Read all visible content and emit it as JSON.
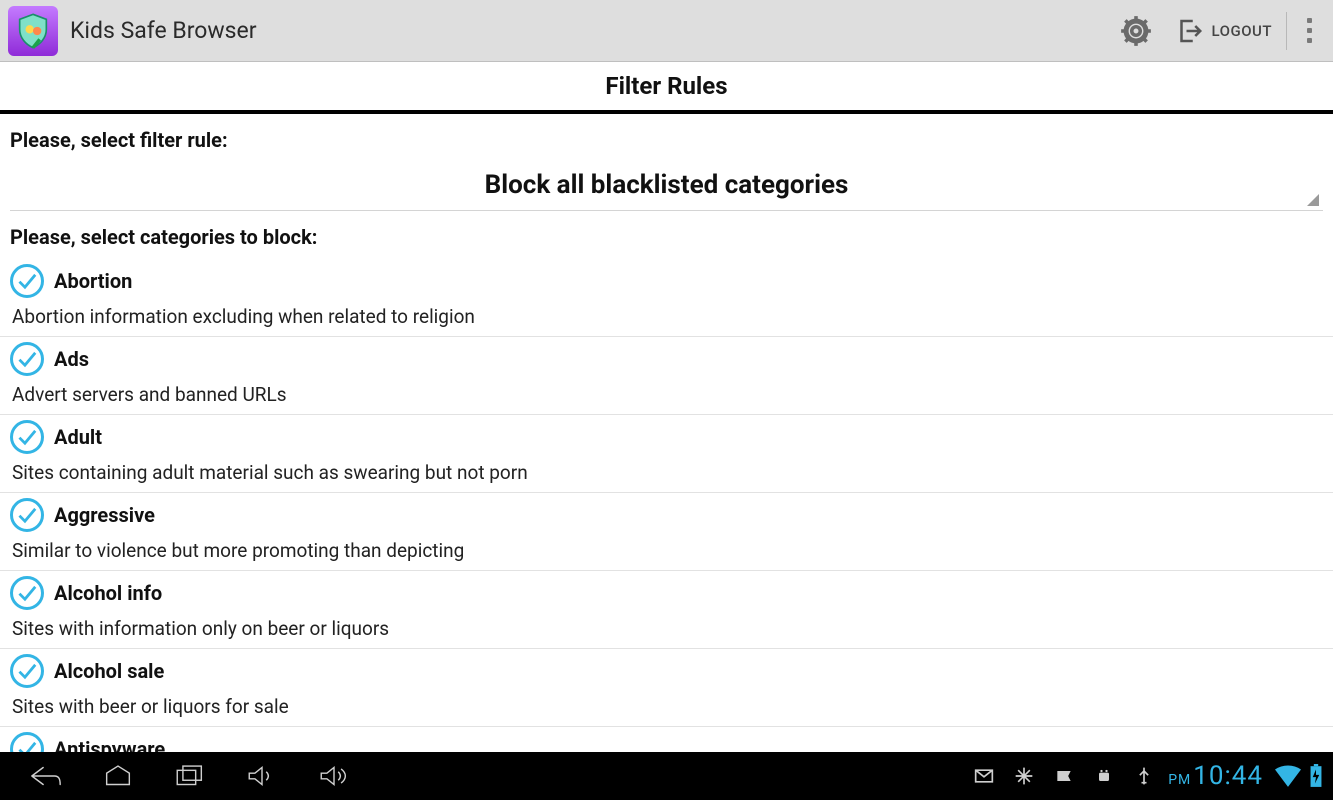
{
  "header": {
    "app_title": "Kids Safe Browser",
    "logout_label": "LOGOUT"
  },
  "page": {
    "title": "Filter Rules",
    "select_rule_label": "Please, select filter rule:",
    "selected_rule": "Block all blacklisted categories",
    "select_categories_label": "Please, select categories to block:",
    "categories": [
      {
        "title": "Abortion",
        "desc": "Abortion information excluding when related to religion",
        "checked": true
      },
      {
        "title": "Ads",
        "desc": "Advert servers and banned URLs",
        "checked": true
      },
      {
        "title": "Adult",
        "desc": "Sites containing adult material such as swearing but not porn",
        "checked": true
      },
      {
        "title": "Aggressive",
        "desc": "Similar to violence but more promoting than depicting",
        "checked": true
      },
      {
        "title": "Alcohol info",
        "desc": "Sites with information only on beer or liquors",
        "checked": true
      },
      {
        "title": "Alcohol sale",
        "desc": "Sites with beer or liquors for sale",
        "checked": true
      },
      {
        "title": "Antispyware",
        "desc": "",
        "checked": true
      }
    ]
  },
  "sysbar": {
    "clock_ampm": "PM",
    "clock_time": "10:44"
  }
}
